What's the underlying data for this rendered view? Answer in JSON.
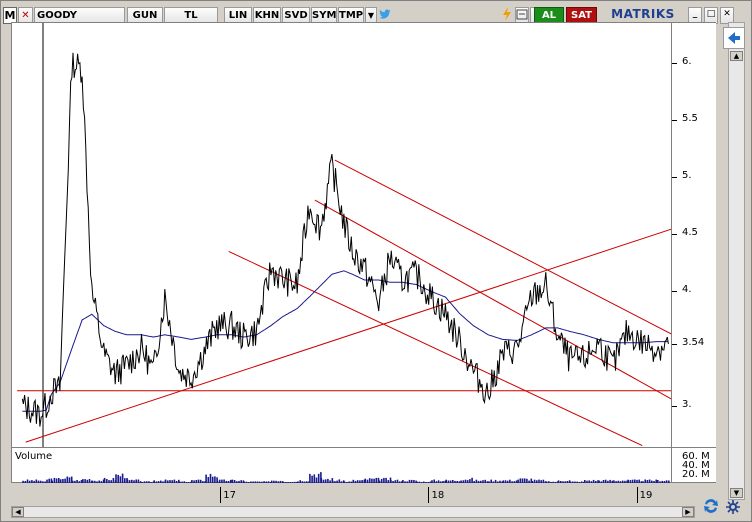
{
  "toolbar": {
    "logo": "M",
    "symbol": "GOODY",
    "period": "GUN",
    "currency": "TL",
    "scale": "LIN",
    "khn": "KHN",
    "svd": "SVD",
    "sym": "SYM",
    "tmp": "TMP",
    "dropdown": "▼",
    "buy": "AL",
    "sell": "SAT",
    "brand": "MATRIKS",
    "close_x": "✕",
    "win_min": "_",
    "win_max": "□",
    "win_close": "✕"
  },
  "colors": {
    "price": "#000000",
    "moving_average": "#1a1a8c",
    "trend": "#cc0000",
    "volume": "#1a1a8c"
  },
  "y_axis": {
    "ticks": [
      "6.",
      "5.5",
      "5.",
      "4.5",
      "4.",
      "3.54",
      "3."
    ],
    "last_price": "3.54"
  },
  "volume": {
    "label": "Volume",
    "ticks": [
      "60. M",
      "40. M",
      "20. M"
    ]
  },
  "x_axis": {
    "ticks": [
      "17",
      "18",
      "19"
    ]
  },
  "chart_data": {
    "type": "line",
    "xlabel": "",
    "ylabel": "",
    "ylim": [
      2.62,
      6.35
    ],
    "grid": false,
    "x": [
      "2016-01-19",
      "2016-02-19",
      "2016-03-01",
      "2016-03-10",
      "2016-03-25",
      "2016-04-15",
      "2016-05-03",
      "2016-05-20",
      "2016-06-10",
      "2016-06-30",
      "2016-07-20",
      "2016-08-15",
      "2016-09-05",
      "2016-09-25",
      "2016-10-20",
      "2016-11-10",
      "2016-12-05",
      "2016-12-25",
      "2017-01-20",
      "2017-02-10",
      "2017-03-05",
      "2017-03-30",
      "2017-04-20",
      "2017-05-15",
      "2017-06-05",
      "2017-06-25",
      "2017-07-15",
      "2017-08-05",
      "2017-08-20",
      "2017-09-10",
      "2017-10-05",
      "2017-10-25",
      "2017-11-15",
      "2017-12-10",
      "2018-01-05",
      "2018-01-30",
      "2018-02-25",
      "2018-03-20",
      "2018-04-15",
      "2018-05-10",
      "2018-06-05",
      "2018-06-30",
      "2018-07-25",
      "2018-08-15",
      "2018-09-05",
      "2018-09-30",
      "2018-10-25",
      "2018-11-20",
      "2018-12-15",
      "2019-01-10",
      "2019-02-05",
      "2019-02-25"
    ],
    "series": [
      {
        "values": [
          3.0,
          2.93,
          3.0,
          3.12,
          3.15,
          6.0,
          5.95,
          4.0,
          3.45,
          3.28,
          3.35,
          3.5,
          3.3,
          3.95,
          3.3,
          3.25,
          3.5,
          3.7,
          3.7,
          3.6,
          3.65,
          4.2,
          4.1,
          4.05,
          4.75,
          4.55,
          5.1,
          4.6,
          4.35,
          4.2,
          3.9,
          4.3,
          4.1,
          4.15,
          3.95,
          3.8,
          3.55,
          3.3,
          3.1,
          3.45,
          3.5,
          3.95,
          4.05,
          3.6,
          3.4,
          3.4,
          3.55,
          3.35,
          3.65,
          3.55,
          3.5,
          3.54
        ]
      },
      {
        "values": [
          2.95,
          2.95,
          2.96,
          3.1,
          3.2,
          3.5,
          3.75,
          3.8,
          3.7,
          3.65,
          3.62,
          3.62,
          3.6,
          3.62,
          3.6,
          3.58,
          3.6,
          3.62,
          3.62,
          3.6,
          3.62,
          3.7,
          3.78,
          3.85,
          3.95,
          4.05,
          4.15,
          4.18,
          4.15,
          4.1,
          4.1,
          4.08,
          4.08,
          4.06,
          4.0,
          3.95,
          3.8,
          3.7,
          3.62,
          3.58,
          3.57,
          3.62,
          3.68,
          3.68,
          3.65,
          3.62,
          3.58,
          3.55,
          3.55,
          3.55,
          3.56,
          3.56
        ]
      }
    ],
    "volume": [
      2,
      1,
      3,
      3,
      4,
      2,
      3,
      2,
      3,
      6,
      2,
      1,
      2,
      2,
      1,
      2,
      6,
      2,
      2,
      1,
      1,
      2,
      1,
      2,
      7,
      3,
      2,
      1,
      2,
      3,
      3,
      2,
      2,
      1,
      2,
      2,
      3,
      2,
      2,
      2,
      3,
      2,
      1,
      2,
      1,
      2,
      2,
      2,
      2,
      2,
      2,
      2
    ]
  }
}
